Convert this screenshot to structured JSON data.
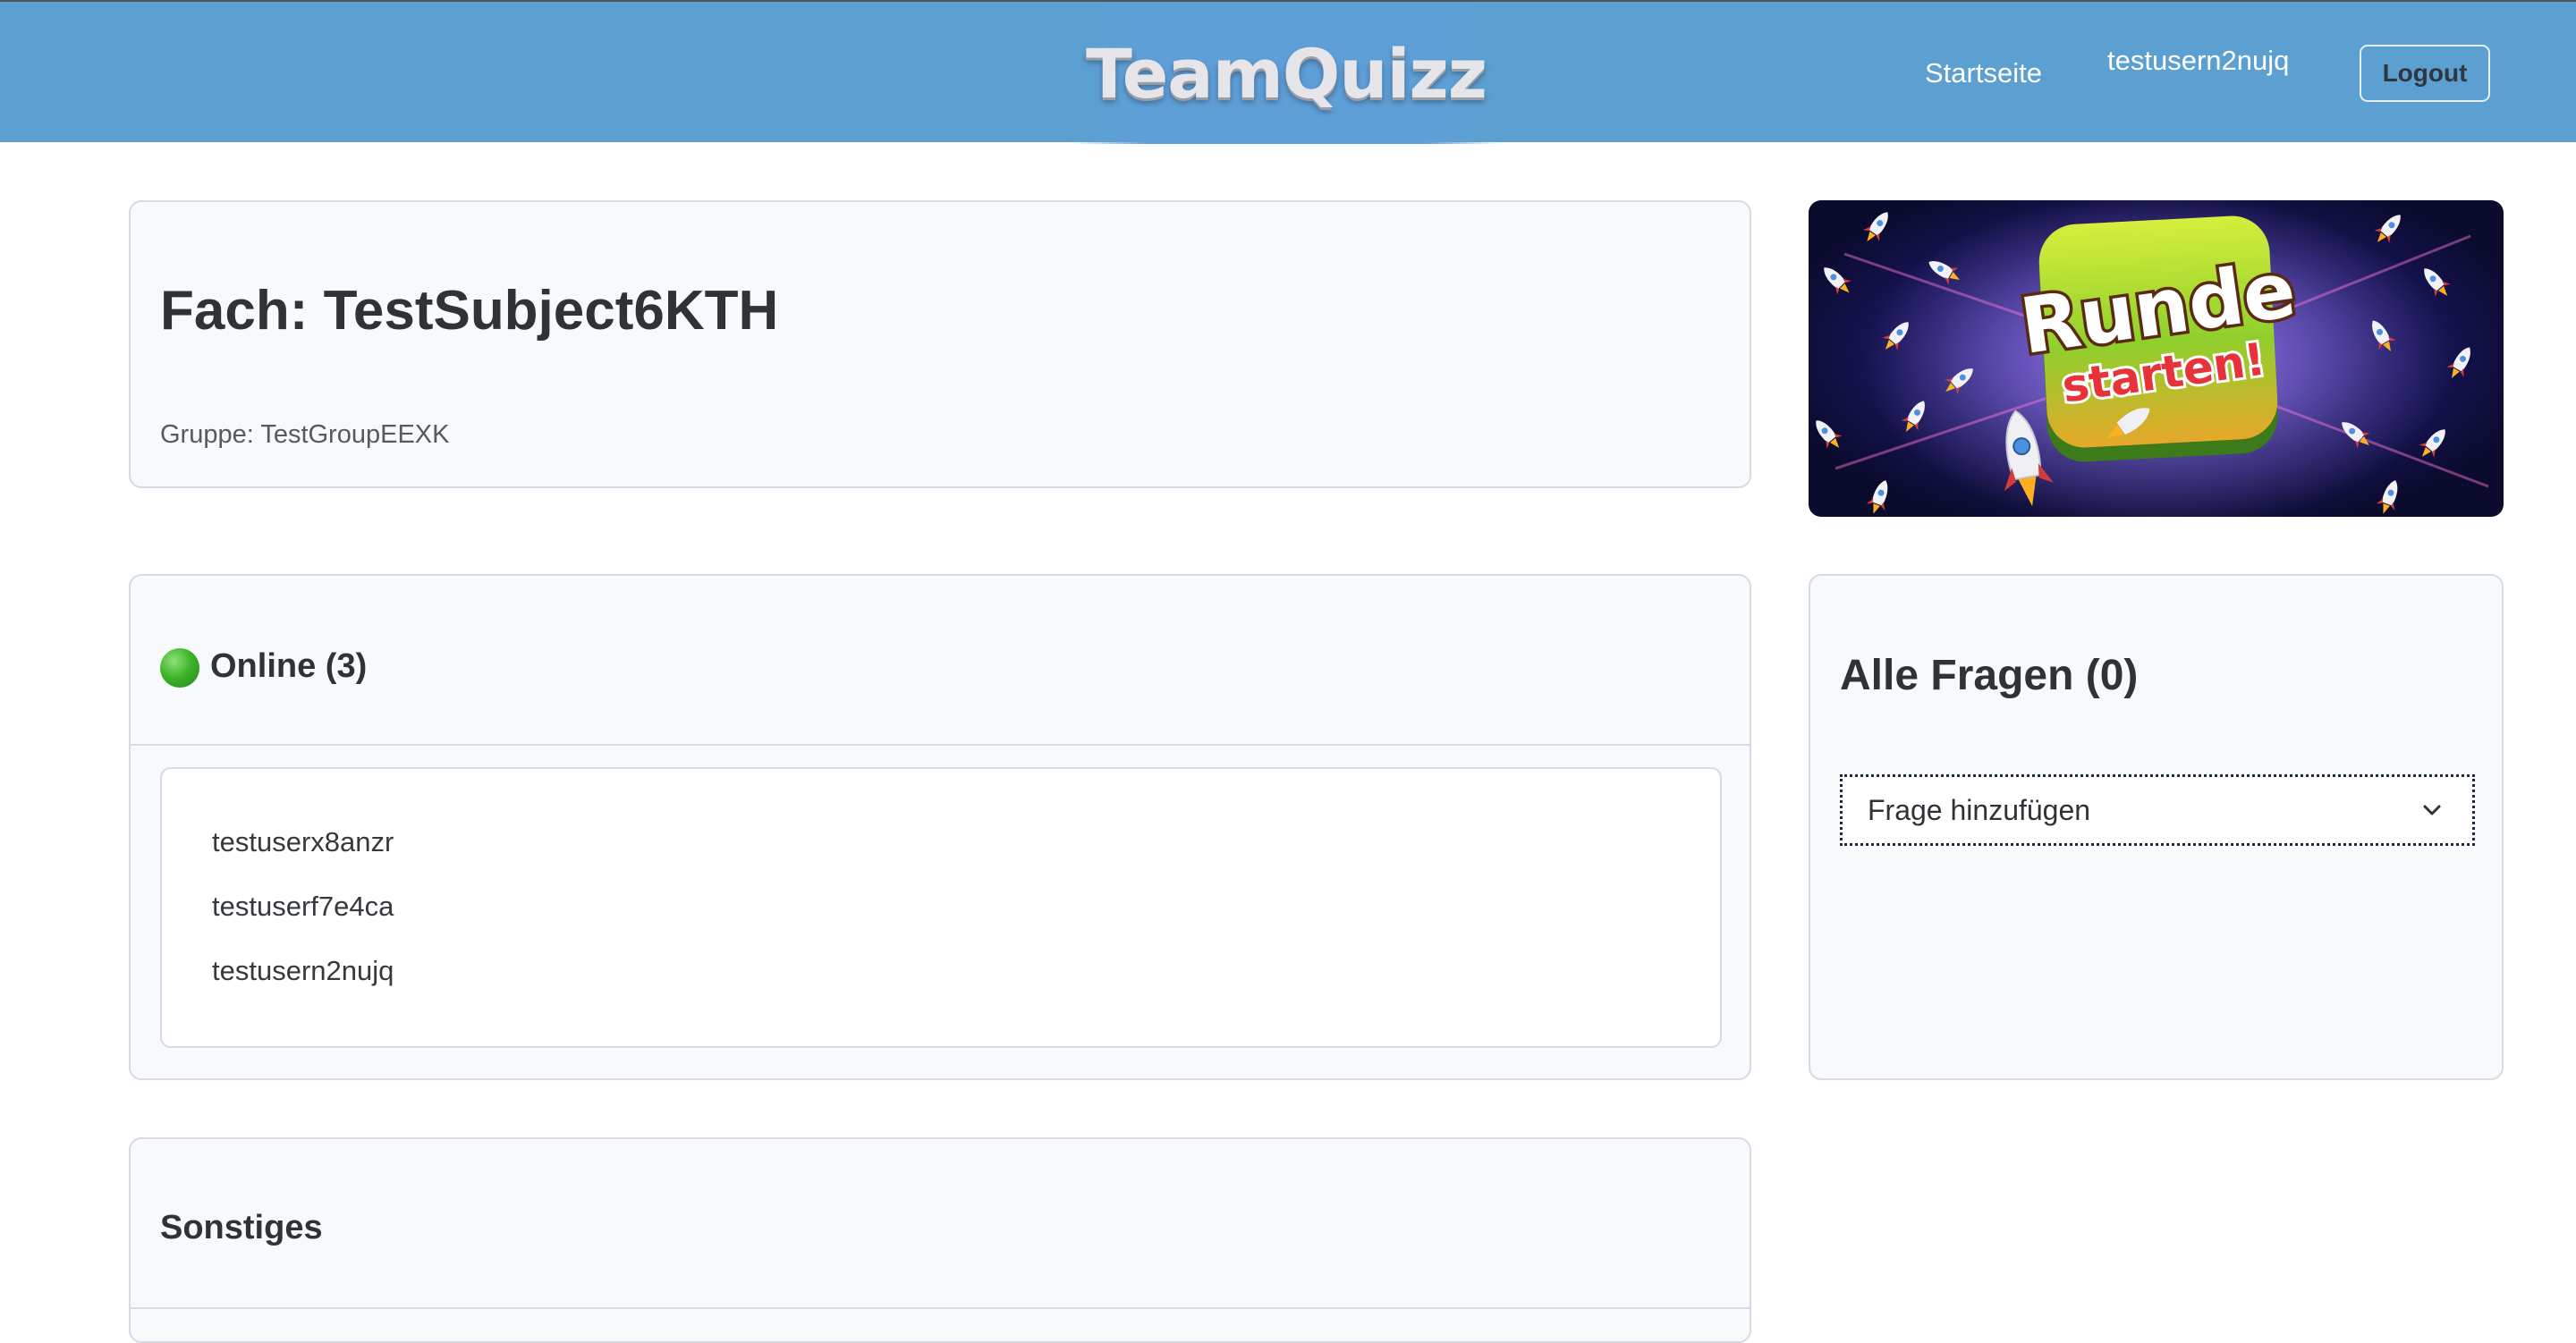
{
  "header": {
    "brand": "TeamQuizz",
    "nav_home": "Startseite",
    "nav_user": "testusern2nujq",
    "logout_label": "Logout"
  },
  "subject": {
    "title": "Fach: TestSubject6KTH",
    "group": "Gruppe: TestGroupEEXK"
  },
  "banner": {
    "line1": "Runde",
    "line2": "starten!"
  },
  "online": {
    "title": "Online (3)",
    "users": [
      "testuserx8anzr",
      "testuserf7e4ca",
      "testusern2nujq"
    ]
  },
  "questions": {
    "title": "Alle Fragen (0)",
    "add_selected": "Frage hinzufügen"
  },
  "misc": {
    "title": "Sonstiges"
  },
  "colors": {
    "navbar": "#5ba0d0",
    "card_bg": "#f8f9fb",
    "online_dot": "#3fb52a"
  }
}
